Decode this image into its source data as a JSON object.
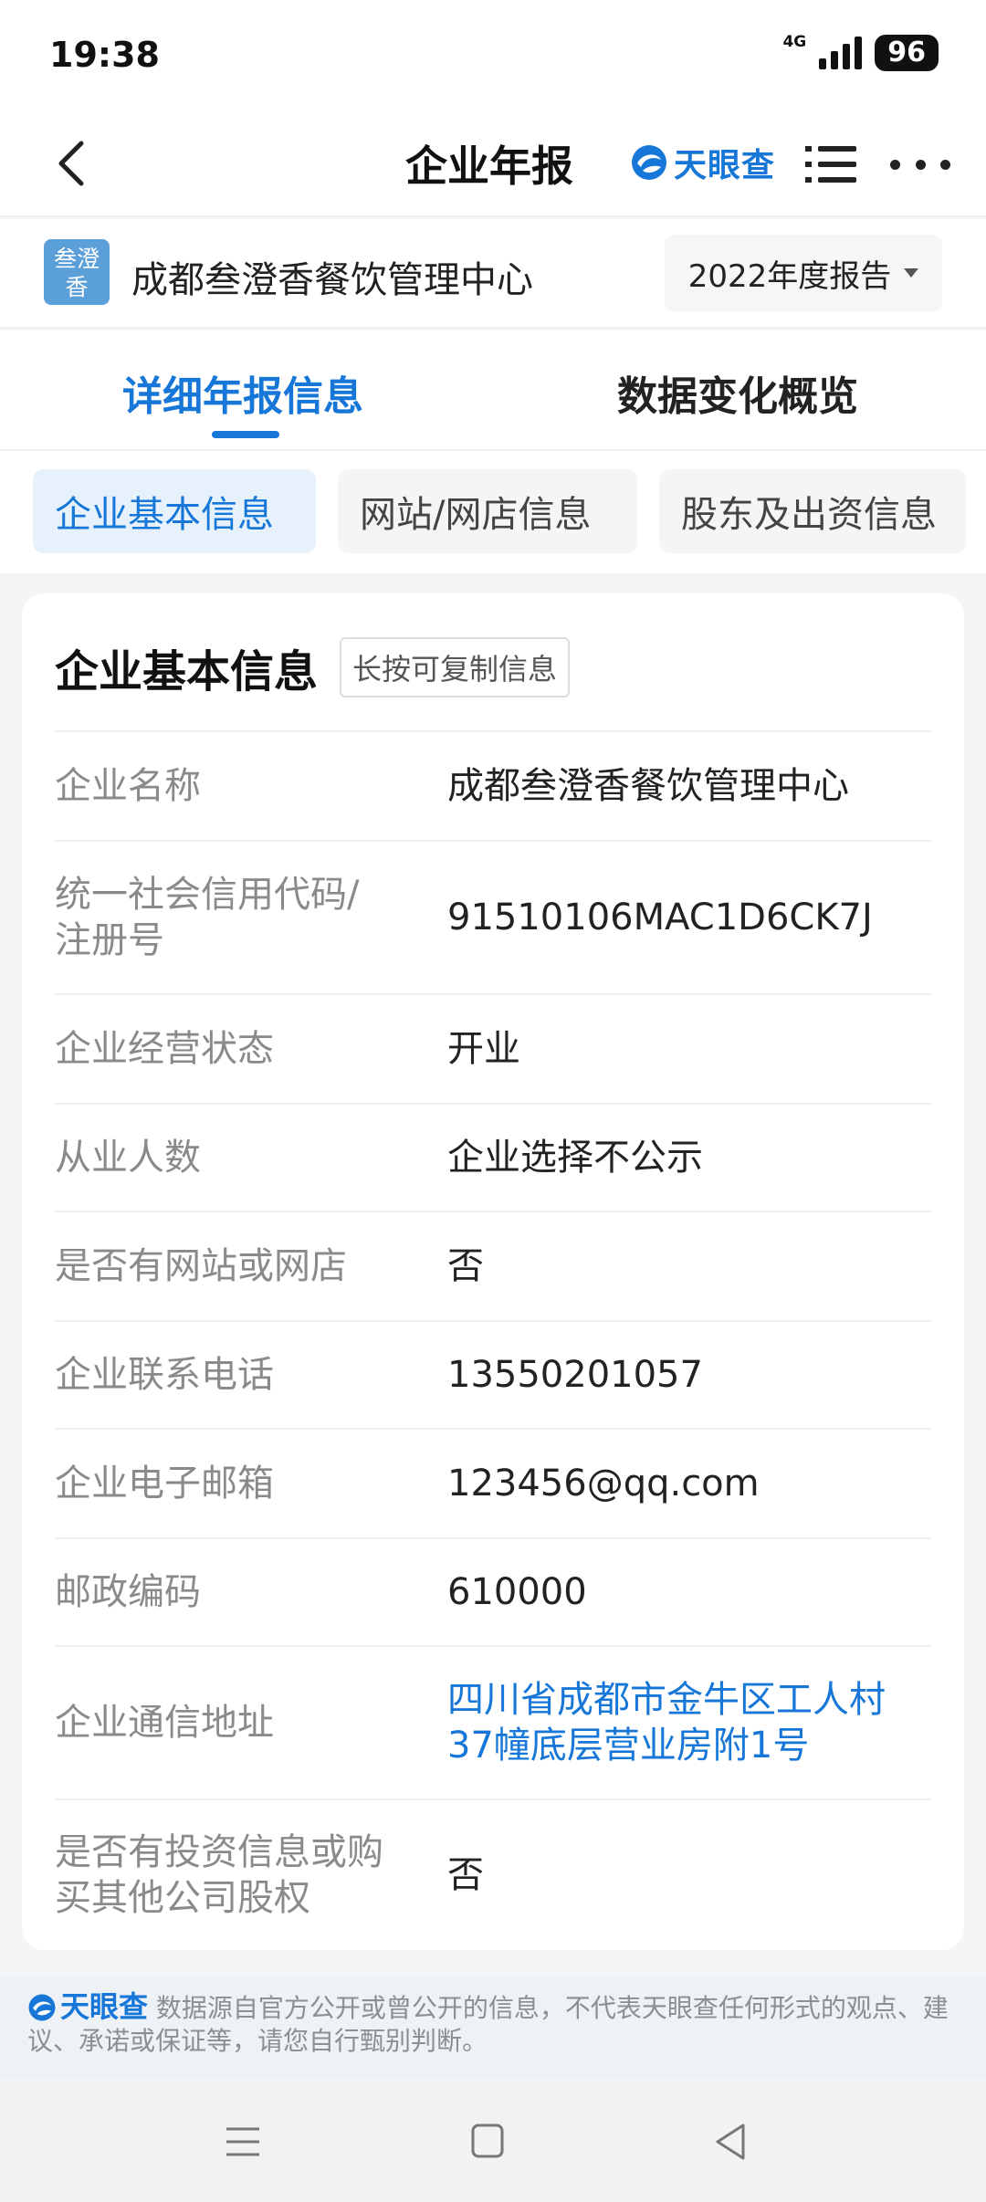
{
  "status_bar": {
    "time": "19:38",
    "network": "4G",
    "battery": "96"
  },
  "nav": {
    "title": "企业年报",
    "brand": "天眼查"
  },
  "company": {
    "logo_text": "叁澄香",
    "name": "成都叁澄香餐饮管理中心",
    "year_select": "2022年度报告"
  },
  "main_tabs": [
    {
      "label": "详细年报信息",
      "active": true
    },
    {
      "label": "数据变化概览",
      "active": false
    }
  ],
  "sub_tabs": [
    {
      "label": "企业基本信息",
      "active": true
    },
    {
      "label": "网站/网店信息",
      "active": false
    },
    {
      "label": "股东及出资信息",
      "active": false
    }
  ],
  "card": {
    "title": "企业基本信息",
    "copy_hint": "长按可复制信息",
    "rows": [
      {
        "label": "企业名称",
        "value": "成都叁澄香餐饮管理中心"
      },
      {
        "label": "统一社会信用代码/注册号",
        "value": "91510106MAC1D6CK7J"
      },
      {
        "label": "企业经营状态",
        "value": "开业"
      },
      {
        "label": "从业人数",
        "value": "企业选择不公示"
      },
      {
        "label": "是否有网站或网店",
        "value": "否"
      },
      {
        "label": "企业联系电话",
        "value": "13550201057"
      },
      {
        "label": "企业电子邮箱",
        "value": "123456@qq.com"
      },
      {
        "label": "邮政编码",
        "value": "610000"
      },
      {
        "label": "企业通信地址",
        "value": "四川省成都市金牛区工人村37幢底层营业房附1号"
      },
      {
        "label": "是否有投资信息或购买其他公司股权",
        "value": "否"
      }
    ]
  },
  "disclaimer": {
    "brand": "天眼查",
    "text": "数据源自官方公开或曾公开的信息，不代表天眼查任何形式的观点、建议、承诺或保证等，请您自行甄别判断。"
  },
  "colors": {
    "accent": "#1677d8",
    "label_gray": "#8a8a8a",
    "chip_active_bg": "#e6f1fc"
  }
}
